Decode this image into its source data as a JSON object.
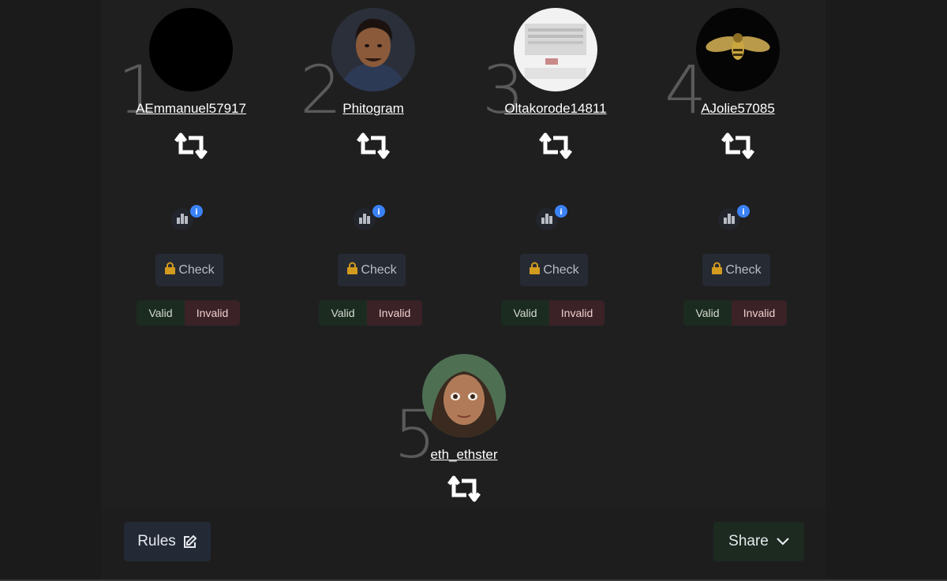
{
  "players": [
    {
      "rank": "1",
      "username": "AEmmanuel57917",
      "check_label": "Check",
      "valid_label": "Valid",
      "invalid_label": "Invalid",
      "avatar": "black-circle-avatar"
    },
    {
      "rank": "2",
      "username": "Phitogram",
      "check_label": "Check",
      "valid_label": "Valid",
      "invalid_label": "Invalid",
      "avatar": "cartoon-man-avatar"
    },
    {
      "rank": "3",
      "username": "Oltakorode14811",
      "check_label": "Check",
      "valid_label": "Valid",
      "invalid_label": "Invalid",
      "avatar": "building-photo-avatar"
    },
    {
      "rank": "4",
      "username": "AJolie57085",
      "check_label": "Check",
      "valid_label": "Valid",
      "invalid_label": "Invalid",
      "avatar": "golden-bee-avatar"
    }
  ],
  "fifth": {
    "rank": "5",
    "username": "eth_ethster",
    "avatar": "cartoon-woman-avatar"
  },
  "footer": {
    "rules_label": "Rules",
    "share_label": "Share"
  },
  "colors": {
    "accent_info": "#3b82f6",
    "lock": "#d39b1e",
    "valid_bg": "#1c2b20",
    "invalid_bg": "#3a2226"
  }
}
